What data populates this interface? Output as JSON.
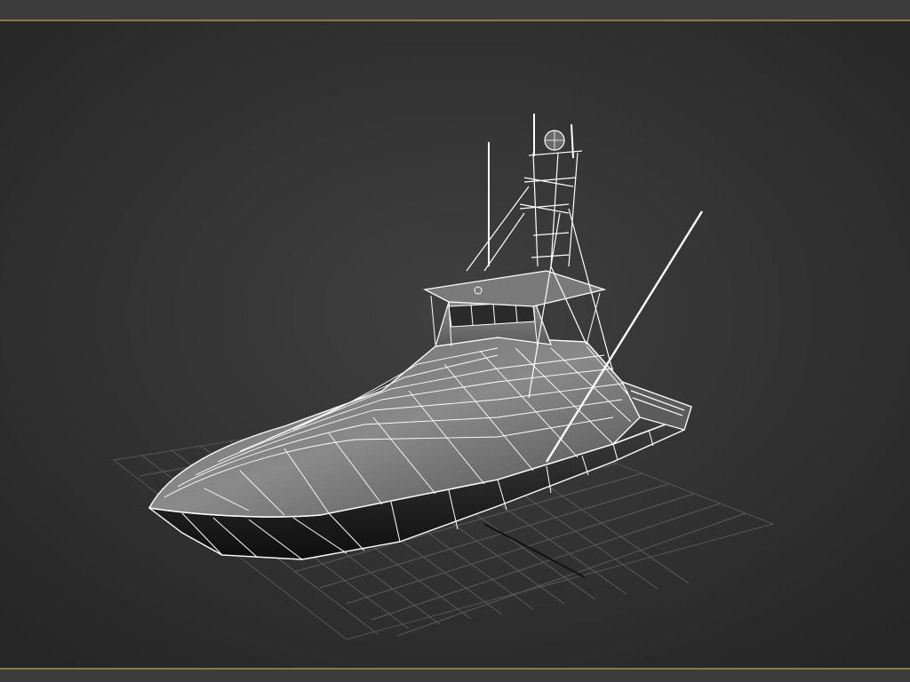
{
  "viewport": {
    "object_name": "sport-fishing-boat-wireframe",
    "shading": "wireframe-over-shaded",
    "background_gradient": [
      "#3e3e3e",
      "#252525"
    ],
    "grid_color": "#5a5a5a",
    "wire_color": "#ffffff",
    "border_accent": "#8a7a48"
  }
}
